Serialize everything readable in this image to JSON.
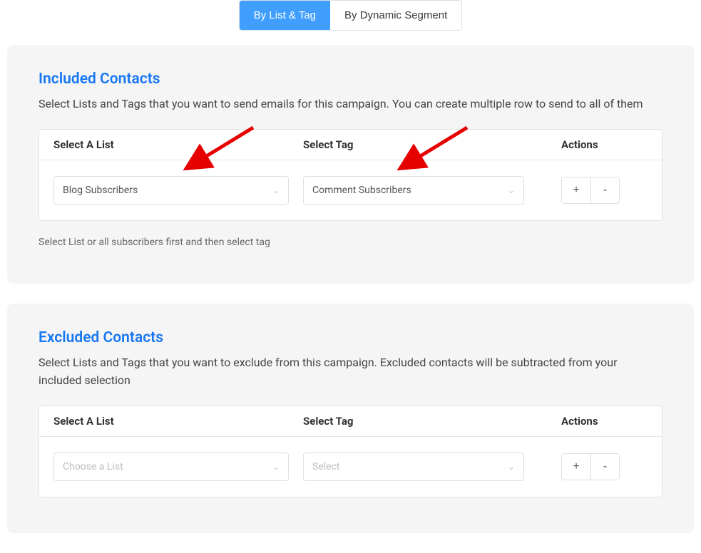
{
  "tabs": {
    "byListTag": "By List & Tag",
    "byDynamicSegment": "By Dynamic Segment"
  },
  "included": {
    "title": "Included Contacts",
    "description": "Select Lists and Tags that you want to send emails for this campaign. You can create multiple row to send to all of them",
    "headers": {
      "list": "Select A List",
      "tag": "Select Tag",
      "actions": "Actions"
    },
    "row": {
      "listValue": "Blog Subscribers",
      "tagValue": "Comment Subscribers",
      "addLabel": "+",
      "removeLabel": "-"
    },
    "hint": "Select List or all subscribers first and then select tag"
  },
  "excluded": {
    "title": "Excluded Contacts",
    "description": "Select Lists and Tags that you want to exclude from this campaign. Excluded contacts will be subtracted from your included selection",
    "headers": {
      "list": "Select A List",
      "tag": "Select Tag",
      "actions": "Actions"
    },
    "row": {
      "listPlaceholder": "Choose a List",
      "tagPlaceholder": "Select",
      "addLabel": "+",
      "removeLabel": "-"
    }
  }
}
